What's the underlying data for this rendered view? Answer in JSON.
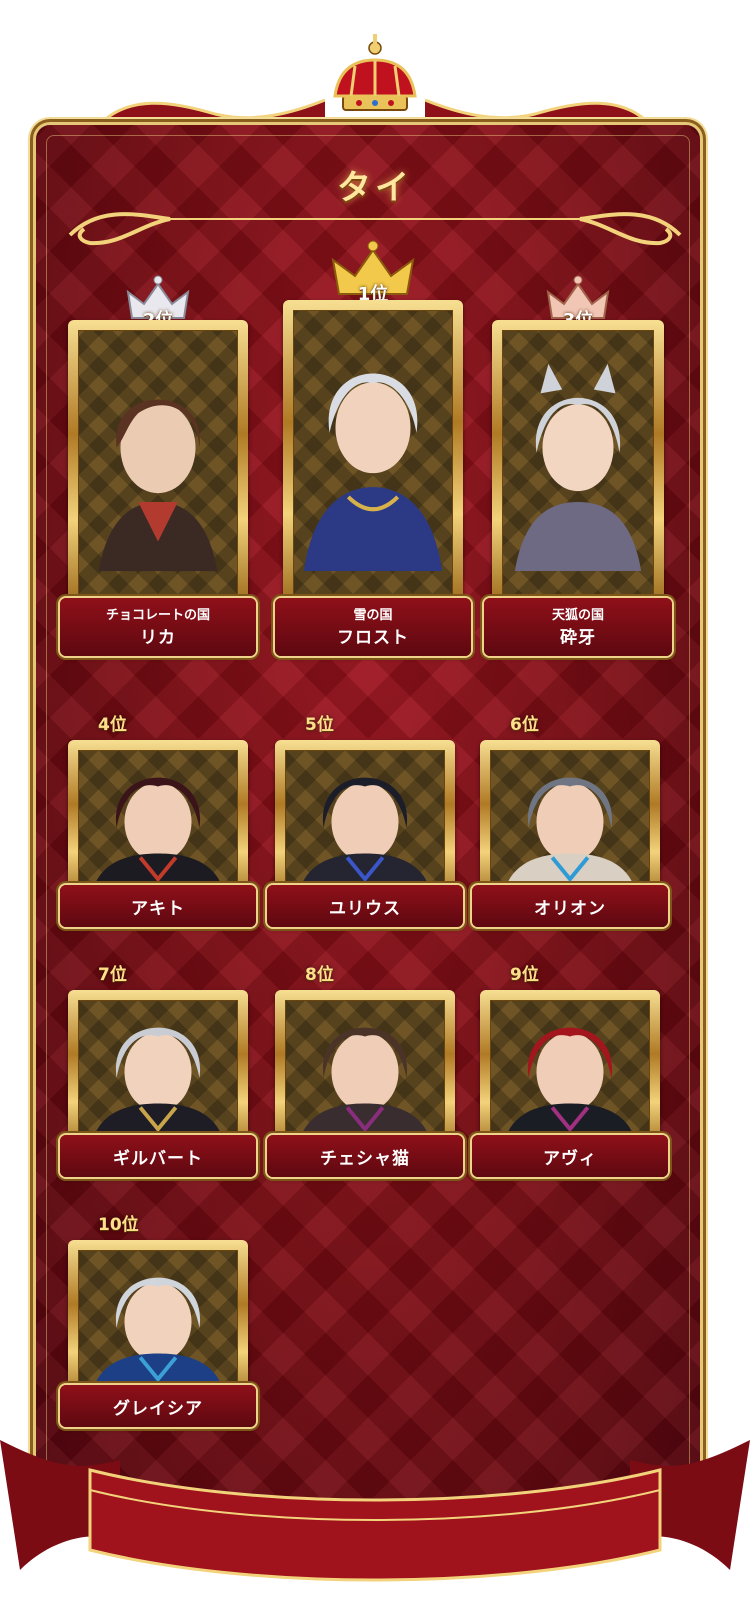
{
  "title": "タイ",
  "ranks": [
    {
      "rank": "1位",
      "country": "雪の国",
      "name": "フロスト",
      "hair": "#d9dde3",
      "skin": "#f1d3bd",
      "outfit": "#2c3a86",
      "accent": "#d7b14a"
    },
    {
      "rank": "2位",
      "country": "チョコレートの国",
      "name": "リカ",
      "hair": "#5a3322",
      "skin": "#eccbb3",
      "outfit": "#3b2a24",
      "accent": "#b33a2e"
    },
    {
      "rank": "3位",
      "country": "天狐の国",
      "name": "砕牙",
      "hair": "#cfd3d9",
      "skin": "#f2d6c2",
      "outfit": "#6f6a84",
      "accent": "#a89fc0"
    },
    {
      "rank": "4位",
      "name": "アキト",
      "hair": "#3a1418",
      "skin": "#efcdb7",
      "outfit": "#1d1b22",
      "accent": "#c23a2a"
    },
    {
      "rank": "5位",
      "name": "ユリウス",
      "hair": "#1b1d29",
      "skin": "#efcdb7",
      "outfit": "#242530",
      "accent": "#3a56c7"
    },
    {
      "rank": "6位",
      "name": "オリオン",
      "hair": "#6f7582",
      "skin": "#efcdb7",
      "outfit": "#d9d0c3",
      "accent": "#2f9bd6"
    },
    {
      "rank": "7位",
      "name": "ギルバート",
      "hair": "#c9ccd2",
      "skin": "#f1d3bd",
      "outfit": "#1e1d26",
      "accent": "#c9a54a"
    },
    {
      "rank": "8位",
      "name": "チェシャ猫",
      "hair": "#4b3328",
      "skin": "#efcdb7",
      "outfit": "#3a2d30",
      "accent": "#8a2d7d"
    },
    {
      "rank": "9位",
      "name": "アヴィ",
      "hair": "#a3161e",
      "skin": "#efcdb7",
      "outfit": "#1b1d24",
      "accent": "#a13080"
    },
    {
      "rank": "10位",
      "name": "グレイシア",
      "hair": "#d0d4db",
      "skin": "#f1d3bd",
      "outfit": "#1d3f86",
      "accent": "#3aa0d6"
    }
  ]
}
